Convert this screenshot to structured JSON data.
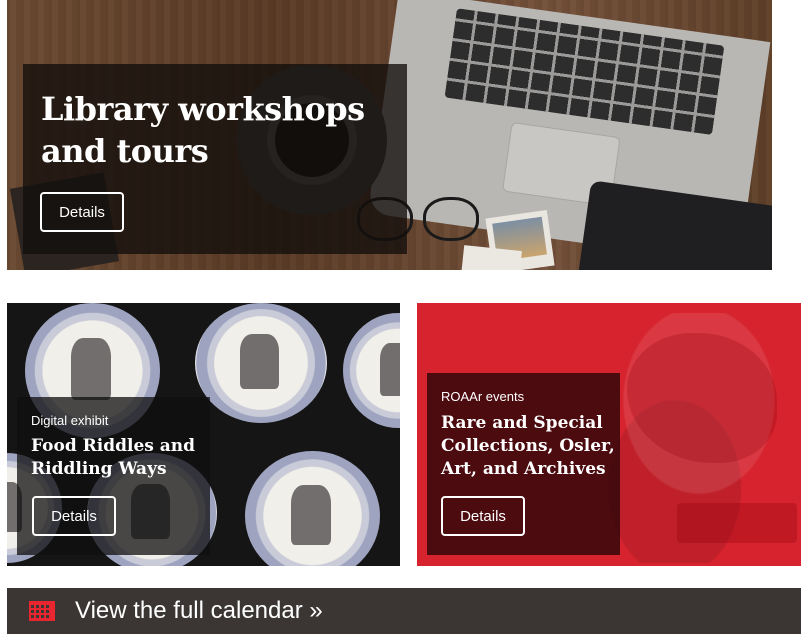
{
  "hero": {
    "title": "Library workshops and tours",
    "button_label": "Details"
  },
  "cards": [
    {
      "eyebrow": "Digital exhibit",
      "title": "Food Riddles and Riddling Ways",
      "button_label": "Details"
    },
    {
      "eyebrow": "ROAAr events",
      "title": "Rare and Special Collections, Osler, Art, and Archives",
      "button_label": "Details"
    }
  ],
  "calendar": {
    "label": "View the full calendar »",
    "icon": "calendar-icon"
  },
  "colors": {
    "accent_red": "#d6232e",
    "calendar_bar": "#3b3634",
    "calendar_icon": "#e8262f"
  }
}
